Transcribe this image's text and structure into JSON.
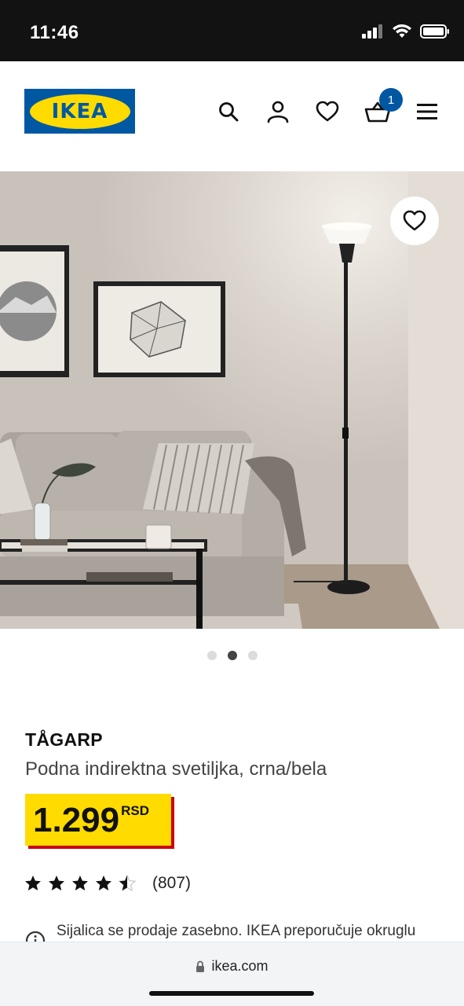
{
  "status_bar": {
    "time": "11:46"
  },
  "header": {
    "logo_text": "IKEA",
    "cart_count": "1",
    "icons": [
      "search-icon",
      "account-icon",
      "favorites-icon",
      "cart-icon",
      "menu-icon"
    ]
  },
  "gallery": {
    "total": 3,
    "active_index": 1
  },
  "product": {
    "name": "TÅGARP",
    "description": "Podna indirektna svetiljka, crna/bela",
    "price": "1.299",
    "currency": "RSD",
    "rating_stars": 4.5,
    "review_count": "(807)",
    "note": "Sijalica se prodaje zasebno. IKEA preporučuje okruglu"
  },
  "browser": {
    "url": "ikea.com"
  },
  "colors": {
    "brand_blue": "#0058a3",
    "brand_yellow": "#ffdb00",
    "price_shadow": "#cc0008"
  }
}
